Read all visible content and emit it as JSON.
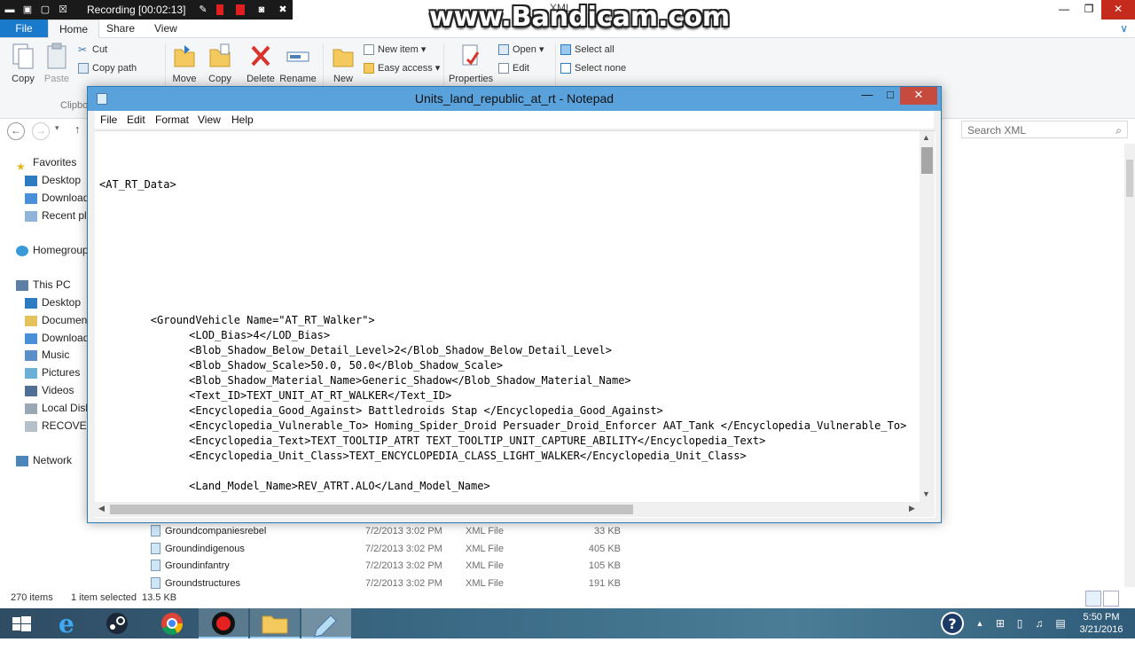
{
  "bandicam": {
    "recording_label": "Recording [00:02:13]",
    "watermark": "www.Bandicam.com"
  },
  "explorer": {
    "title": "XML",
    "tabs": {
      "file": "File",
      "home": "Home",
      "share": "Share",
      "view": "View"
    },
    "ribbon": {
      "copy": "Copy",
      "paste": "Paste",
      "cut": "Cut",
      "copy_path": "Copy path",
      "clipboard_group": "Clipbo",
      "move": "Move",
      "copy2": "Copy",
      "delete": "Delete",
      "rename": "Rename",
      "new": "New",
      "new_item": "New item",
      "easy_access": "Easy access",
      "properties": "Properties",
      "open": "Open",
      "edit": "Edit",
      "select_all": "Select all",
      "select_none": "Select none"
    },
    "search_placeholder": "Search XML",
    "nav": {
      "favorites": "Favorites",
      "desktop": "Desktop",
      "downloads": "Download",
      "recent": "Recent pla",
      "homegroup": "Homegroup",
      "this_pc": "This PC",
      "pc_desktop": "Desktop",
      "documents": "Documen",
      "pc_downloads": "Download",
      "music": "Music",
      "pictures": "Pictures",
      "videos": "Videos",
      "local_disk": "Local Disk",
      "recovery": "RECOVERY",
      "network": "Network"
    },
    "files": [
      {
        "name": "Groundcompaniesrebel",
        "date": "7/2/2013 3:02 PM",
        "type": "XML File",
        "size": "33 KB"
      },
      {
        "name": "Groundindigenous",
        "date": "7/2/2013 3:02 PM",
        "type": "XML File",
        "size": "405 KB"
      },
      {
        "name": "Groundinfantry",
        "date": "7/2/2013 3:02 PM",
        "type": "XML File",
        "size": "105 KB"
      },
      {
        "name": "Groundstructures",
        "date": "7/2/2013 3:02 PM",
        "type": "XML File",
        "size": "191 KB"
      }
    ],
    "status": {
      "count": "270 items",
      "selected": "1 item selected",
      "size": "13.5 KB"
    }
  },
  "notepad": {
    "title": "Units_land_republic_at_rt - Notepad",
    "menu": {
      "file": "File",
      "edit": "Edit",
      "format": "Format",
      "view": "View",
      "help": "Help"
    },
    "lines": {
      "l1": "<AT_RT_Data>",
      "l2": "        <GroundVehicle Name=\"AT_RT_Walker\">",
      "l3": "              <LOD_Bias>4</LOD_Bias>",
      "l4": "              <Blob_Shadow_Below_Detail_Level>2</Blob_Shadow_Below_Detail_Level>",
      "l5": "              <Blob_Shadow_Scale>50.0, 50.0</Blob_Shadow_Scale>",
      "l6": "              <Blob_Shadow_Material_Name>Generic_Shadow</Blob_Shadow_Material_Name>",
      "l7": "              <Text_ID>TEXT_UNIT_AT_RT_WALKER</Text_ID>",
      "l8": "              <Encyclopedia_Good_Against> Battledroids Stap </Encyclopedia_Good_Against>",
      "l9": "              <Encyclopedia_Vulnerable_To> Homing_Spider_Droid Persuader_Droid_Enforcer AAT_Tank </Encyclopedia_Vulnerable_To>",
      "l10": "              <Encyclopedia_Text>TEXT_TOOLTIP_ATRT TEXT_TOOLTIP_UNIT_CAPTURE_ABILITY</Encyclopedia_Text>",
      "l11": "              <Encyclopedia_Unit_Class>TEXT_ENCYCLOPEDIA_CLASS_LIGHT_WALKER</Encyclopedia_Unit_Class>",
      "l12": "              <Land_Model_Name>REV_ATRT.ALO</Land_Model_Name>"
    }
  },
  "taskbar": {
    "time": "5:50 PM",
    "date": "3/21/2016"
  }
}
